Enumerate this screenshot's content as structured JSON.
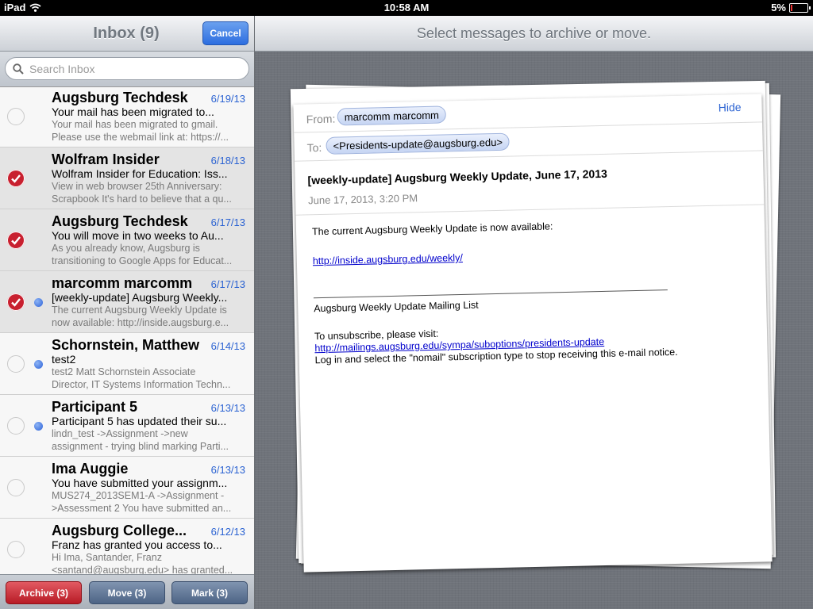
{
  "status_bar": {
    "device": "iPad",
    "time": "10:58 AM",
    "battery": "5%"
  },
  "master": {
    "title": "Inbox (9)",
    "cancel_label": "Cancel",
    "search_placeholder": "Search Inbox",
    "messages": [
      {
        "sender": "Augsburg Techdesk",
        "date": "6/19/13",
        "subject": "Your mail has been migrated to...",
        "preview1": "Your mail has been migrated to gmail.",
        "preview2": "Please use the webmail link at: https://...",
        "selected": false,
        "unread": false
      },
      {
        "sender": "Wolfram Insider",
        "date": "6/18/13",
        "subject": "Wolfram Insider for Education: Iss...",
        "preview1": "View in web browser 25th Anniversary:",
        "preview2": "Scrapbook It's hard to believe that a qu...",
        "selected": true,
        "unread": false
      },
      {
        "sender": "Augsburg Techdesk",
        "date": "6/17/13",
        "subject": "You will move in two weeks to Au...",
        "preview1": "As you already know, Augsburg is",
        "preview2": "transitioning to Google Apps for Educat...",
        "selected": true,
        "unread": false
      },
      {
        "sender": "marcomm marcomm",
        "date": "6/17/13",
        "subject": "[weekly-update] Augsburg Weekly...",
        "preview1": "The current Augsburg Weekly Update is",
        "preview2": "now available: http://inside.augsburg.e...",
        "selected": true,
        "unread": true
      },
      {
        "sender": "Schornstein, Matthew",
        "date": "6/14/13",
        "subject": "test2",
        "preview1": "test2 Matt Schornstein Associate",
        "preview2": "Director, IT Systems Information Techn...",
        "selected": false,
        "unread": true
      },
      {
        "sender": "Participant 5",
        "date": "6/13/13",
        "subject": "Participant 5 has updated their su...",
        "preview1": "lindn_test ->Assignment ->new",
        "preview2": "assignment - trying blind marking Parti...",
        "selected": false,
        "unread": true
      },
      {
        "sender": "Ima Auggie",
        "date": "6/13/13",
        "subject": "You have submitted your assignm...",
        "preview1": "MUS274_2013SEM1-A ->Assignment -",
        "preview2": ">Assessment 2 You have submitted an...",
        "selected": false,
        "unread": false
      },
      {
        "sender": "Augsburg College...",
        "date": "6/12/13",
        "subject": "Franz has granted you access to...",
        "preview1": "Hi Ima, Santander, Franz",
        "preview2": "<santand@augsburg.edu> has granted...",
        "selected": false,
        "unread": false
      }
    ],
    "toolbar": {
      "archive": "Archive (3)",
      "move": "Move (3)",
      "mark": "Mark (3)"
    }
  },
  "detail": {
    "title": "Select messages to archive or move.",
    "email": {
      "from_label": "From:",
      "from": "marcomm marcomm",
      "to_label": "To:",
      "to": "<Presidents-update@augsburg.edu>",
      "hide_label": "Hide",
      "subject": "[weekly-update] Augsburg Weekly Update, June 17, 2013",
      "date": "June 17, 2013, 3:20 PM",
      "body_intro": "The current Augsburg Weekly Update is now available:",
      "link1": "http://inside.augsburg.edu/weekly/",
      "list_name": "Augsburg Weekly Update Mailing List",
      "unsub_text": "To unsubscribe, please visit:",
      "link2": "http://mailings.augsburg.edu/sympa/suboptions/presidents-update",
      "unsub_instructions": "Log in and select the \"nomail\" subscription type to stop receiving this e-mail notice."
    }
  },
  "colors": {
    "accent_blue": "#2a62d2",
    "archive_red": "#c8202f",
    "check_red": "#c8202f"
  }
}
